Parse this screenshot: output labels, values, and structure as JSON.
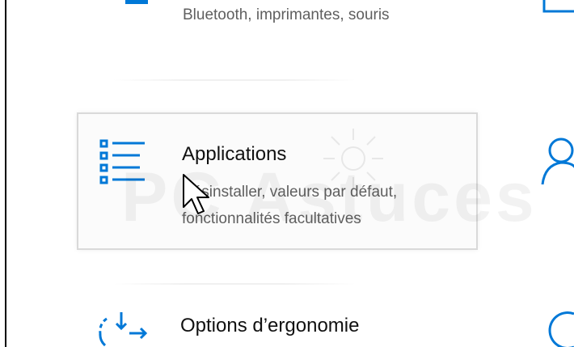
{
  "tiles": {
    "devices": {
      "description": "Bluetooth, imprimantes, souris",
      "icon": "keyboard-icon"
    },
    "apps": {
      "title": "Applications",
      "description_line1": "Désinstaller, valeurs par défaut,",
      "description_line2": "fonctionnalités facultatives",
      "icon": "apps-list-icon",
      "state": "selected"
    },
    "ergonomics": {
      "title": "Options d’ergonomie",
      "icon": "ease-of-access-icon"
    }
  },
  "right_column_icons": [
    "device-icon",
    "accounts-person-icon",
    "search-circle-icon"
  ],
  "watermark": {
    "text": "PC Astuces"
  },
  "colors": {
    "accent": "#0078d7",
    "title_text": "#111111",
    "description_text": "#5f5f5f",
    "selected_border": "#d9d9d9"
  }
}
